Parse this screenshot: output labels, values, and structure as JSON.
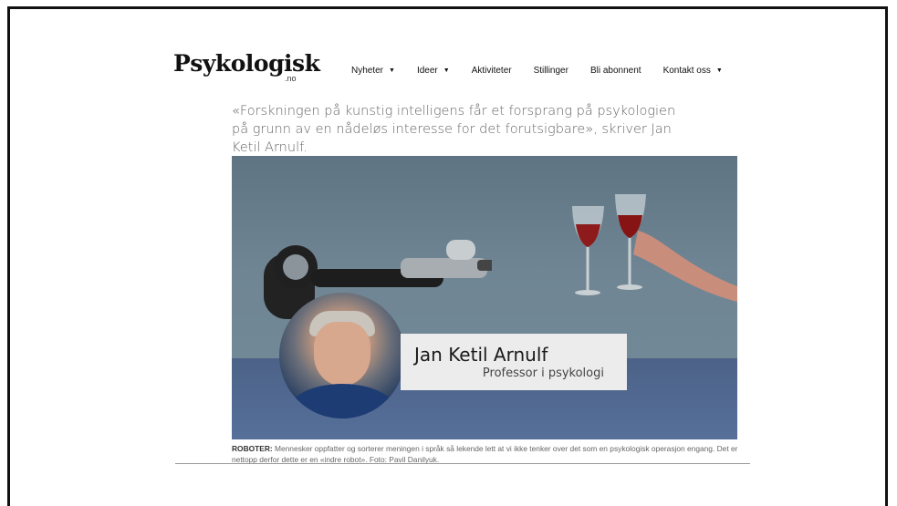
{
  "site": {
    "logo": "Psykologisk",
    "logo_suffix": ".no"
  },
  "nav": {
    "items": [
      {
        "label": "Nyheter",
        "has_dropdown": true
      },
      {
        "label": "Ideer",
        "has_dropdown": true
      },
      {
        "label": "Aktiviteter",
        "has_dropdown": false
      },
      {
        "label": "Stillinger",
        "has_dropdown": false
      },
      {
        "label": "Bli abonnent",
        "has_dropdown": false
      },
      {
        "label": "Kontakt oss",
        "has_dropdown": true
      }
    ]
  },
  "article": {
    "lead": "«Forskningen på kunstig intelligens får et forsprang på psykologien på grunn av en nådeløs interesse for det forutsigbare», skriver Jan Ketil Arnulf.",
    "author_name": "Jan Ketil Arnulf",
    "author_title": "Professor i psykologi",
    "caption_label": "ROBOTER:",
    "caption_text": " Mennesker oppfatter og sorterer meningen i språk så lekende lett at vi ikke tenker over det som en psykologisk operasjon engang. Det er nettopp derfor dette er en «indre robot». Foto: Pavil Danilyuk."
  }
}
